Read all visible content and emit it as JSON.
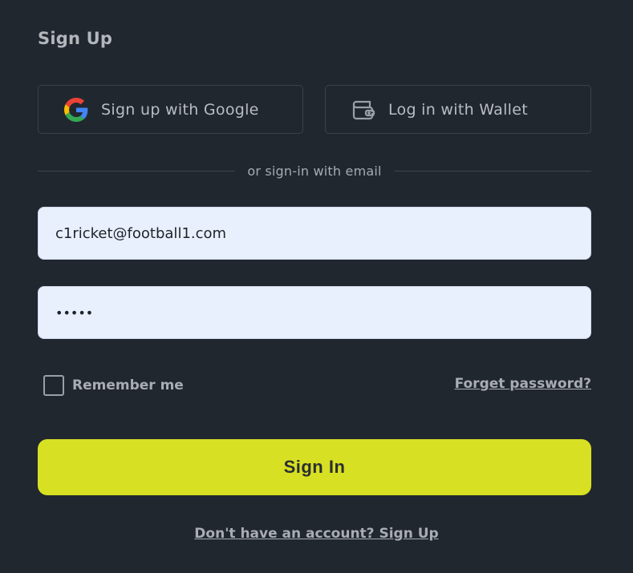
{
  "form": {
    "title": "Sign Up",
    "google_button_label": "Sign up with Google",
    "wallet_button_label": "Log in with Wallet",
    "divider_text": "or sign-in with email",
    "email_value": "c1ricket@football1.com",
    "password_value": "•••••",
    "remember_label": "Remember me",
    "remember_checked": false,
    "forget_password_label": "Forget password?",
    "sign_in_label": "Sign In",
    "signup_link_label": "Don't have an account? Sign Up"
  },
  "icons": {
    "google": "google-logo-icon",
    "wallet": "wallet-icon"
  },
  "colors": {
    "background": "#21272f",
    "accent": "#d7e022",
    "input_background": "#e8f0fe"
  }
}
